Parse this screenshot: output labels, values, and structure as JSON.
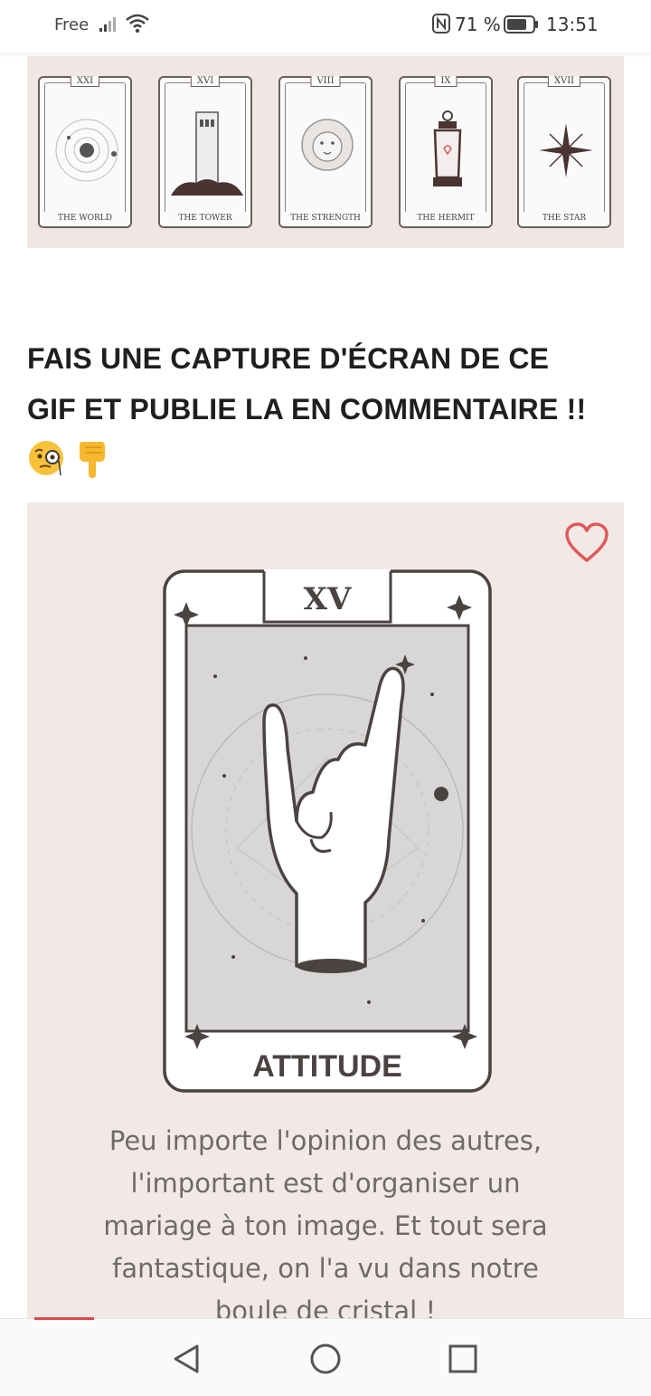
{
  "status_bar": {
    "carrier": "Free",
    "battery_percent": "71 %",
    "time": "13:51",
    "icons": [
      "signal-icon",
      "wifi-icon",
      "nfc-icon",
      "battery-icon"
    ]
  },
  "top_cards": [
    {
      "numeral": "XXI",
      "name": "THE WORLD",
      "icon": "planet-icon"
    },
    {
      "numeral": "XVI",
      "name": "THE TOWER",
      "icon": "tower-icon"
    },
    {
      "numeral": "VIII",
      "name": "THE STRENGTH",
      "icon": "lion-icon"
    },
    {
      "numeral": "IX",
      "name": "THE HERMIT",
      "icon": "lantern-icon"
    },
    {
      "numeral": "XVII",
      "name": "THE STAR",
      "icon": "star-icon"
    }
  ],
  "headline": {
    "line1": "FAIS UNE CAPTURE D'ÉCRAN DE CE",
    "line2": "GIF ET PUBLIE LA EN COMMENTAIRE !!",
    "emojis": [
      "monocle-face-icon",
      "pointing-down-icon"
    ]
  },
  "main_card": {
    "numeral": "XV",
    "title": "ATTITUDE",
    "description": "Peu importe l'opinion des autres, l'important est d'organiser un mariage à ton image. Et tout sera fantastique, on l'a vu dans notre boule de cristal !",
    "desc_lines": [
      "Peu importe l'opinion des autres,",
      "l'important est d'organiser un",
      "mariage à ton image. Et tout sera",
      "fantastique, on l'a vu dans notre",
      "boule de cristal !"
    ],
    "like_icon": "heart-outline-icon"
  },
  "nav_bar": {
    "buttons": [
      "back-icon",
      "home-icon",
      "recents-icon"
    ]
  },
  "colors": {
    "card_background": "#f2e9e7",
    "heart": "#e05a5a",
    "accent_bar": "#e04848",
    "text_dark": "#1f1f1f",
    "text_muted": "#6e6a69"
  }
}
